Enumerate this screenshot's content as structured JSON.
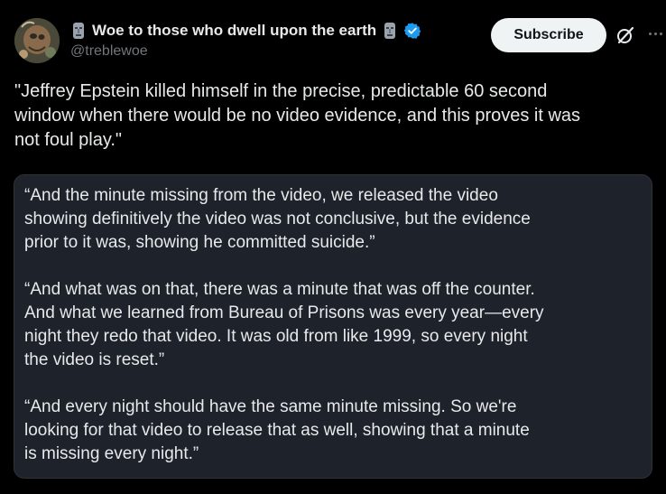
{
  "author": {
    "display_name": "Woe to those who dwell upon the earth",
    "handle": "@treblewoe",
    "verified": true,
    "avatar_icon": "avatar-painting",
    "name_emoji_icon": "moai-icon"
  },
  "actions": {
    "subscribe_label": "Subscribe",
    "grok_icon": "grok-icon",
    "more_icon": "more-options-icon"
  },
  "post": {
    "text": "\"Jeffrey Epstein killed himself in the precise, predictable 60 second\nwindow when there would be no video evidence, and this proves it was\nnot foul play.\""
  },
  "quote": {
    "paragraphs": [
      "“And the minute missing from the video, we released the video\nshowing definitively the video was not conclusive, but the evidence\nprior to it was, showing he committed suicide.”",
      "“And what was on that, there was a minute that was off the counter.\nAnd what we learned from Bureau of Prisons was every year—every\nnight they redo that video. It was old from like 1999, so every night\nthe video is reset.”",
      "“And every night should have the same minute missing. So we're\nlooking for that video to release that as well, showing that a minute\nis missing every night.”"
    ]
  },
  "colors": {
    "background": "#000000",
    "text": "#e7e9ea",
    "muted": "#71767b",
    "verified_blue": "#1d9bf0",
    "card_bg": "#1d222b",
    "button_bg": "#eff3f4"
  }
}
